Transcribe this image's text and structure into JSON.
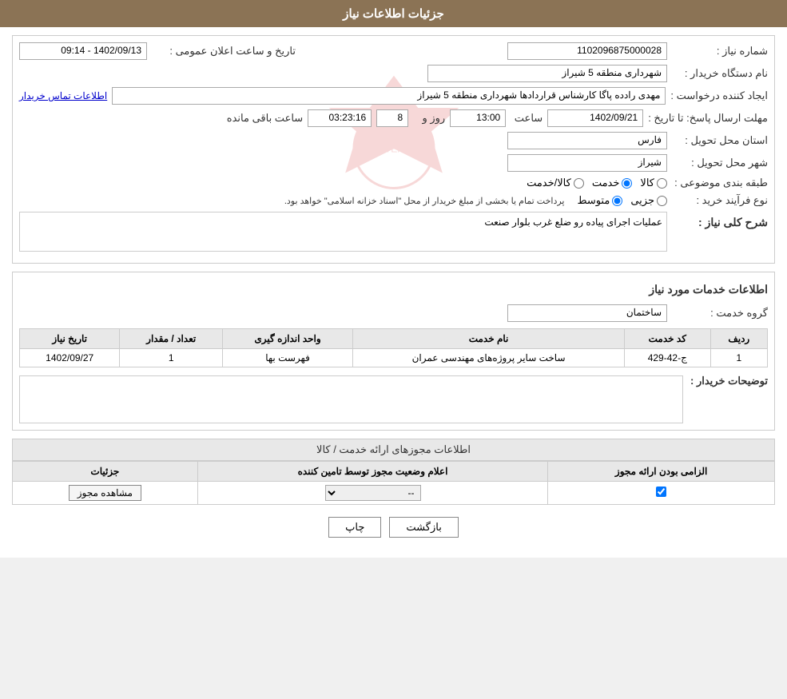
{
  "header": {
    "title": "جزئیات اطلاعات نیاز"
  },
  "fields": {
    "need_number_label": "شماره نیاز :",
    "need_number_value": "1102096875000028",
    "buyer_dept_label": "نام دستگاه خریدار :",
    "buyer_dept_value": "شهرداری منطقه 5 شیراز",
    "creator_label": "ایجاد کننده درخواست :",
    "creator_value": "مهدی رادده پاگا کارشناس قراردادها شهرداری منطقه 5 شیراز",
    "creator_link": "اطلاعات تماس خریدار",
    "announce_time_label": "تاریخ و ساعت اعلان عمومی :",
    "announce_time_value": "1402/09/13 - 09:14",
    "deadline_label": "مهلت ارسال پاسخ: تا تاریخ :",
    "deadline_date": "1402/09/21",
    "deadline_time_label": "ساعت",
    "deadline_time": "13:00",
    "deadline_days_label": "روز و",
    "deadline_days": "8",
    "deadline_remaining_label": "ساعت باقی مانده",
    "deadline_remaining": "03:23:16",
    "province_label": "استان محل تحویل :",
    "province_value": "فارس",
    "city_label": "شهر محل تحویل :",
    "city_value": "شیراز",
    "category_label": "طبقه بندی موضوعی :",
    "category_kala": "کالا",
    "category_khedmat": "خدمت",
    "category_kala_khedmat": "کالا/خدمت",
    "purchase_type_label": "نوع فرآیند خرید :",
    "purchase_type_jozyi": "جزیی",
    "purchase_type_mottavaset": "متوسط",
    "purchase_type_desc": "پرداخت تمام یا بخشی از مبلغ خریدار از محل \"اسناد خزانه اسلامی\" خواهد بود.",
    "need_desc_label": "شرح کلی نیاز :",
    "need_desc_value": "عملیات اجرای پیاده رو ضلع غرب بلوار صنعت"
  },
  "services_section": {
    "title": "اطلاعات خدمات مورد نیاز",
    "group_label": "گروه خدمت :",
    "group_value": "ساختمان",
    "table": {
      "columns": [
        "ردیف",
        "کد خدمت",
        "نام خدمت",
        "واحد اندازه گیری",
        "تعداد / مقدار",
        "تاریخ نیاز"
      ],
      "rows": [
        {
          "row": "1",
          "code": "ج-42-429",
          "name": "ساخت سایر پروژه‌های مهندسی عمران",
          "unit": "فهرست بها",
          "quantity": "1",
          "date": "1402/09/27"
        }
      ]
    }
  },
  "buyer_notes_label": "توضیحات خریدار :",
  "buyer_notes_value": "",
  "permit_section": {
    "title": "اطلاعات مجوزهای ارائه خدمت / کالا",
    "table": {
      "columns": [
        "الزامی بودن ارائه مجوز",
        "اعلام وضعیت مجوز توسط تامین کننده",
        "جزئیات"
      ],
      "rows": [
        {
          "required": true,
          "status": "--",
          "details": "مشاهده مجوز"
        }
      ]
    }
  },
  "buttons": {
    "print_label": "چاپ",
    "back_label": "بازگشت"
  }
}
